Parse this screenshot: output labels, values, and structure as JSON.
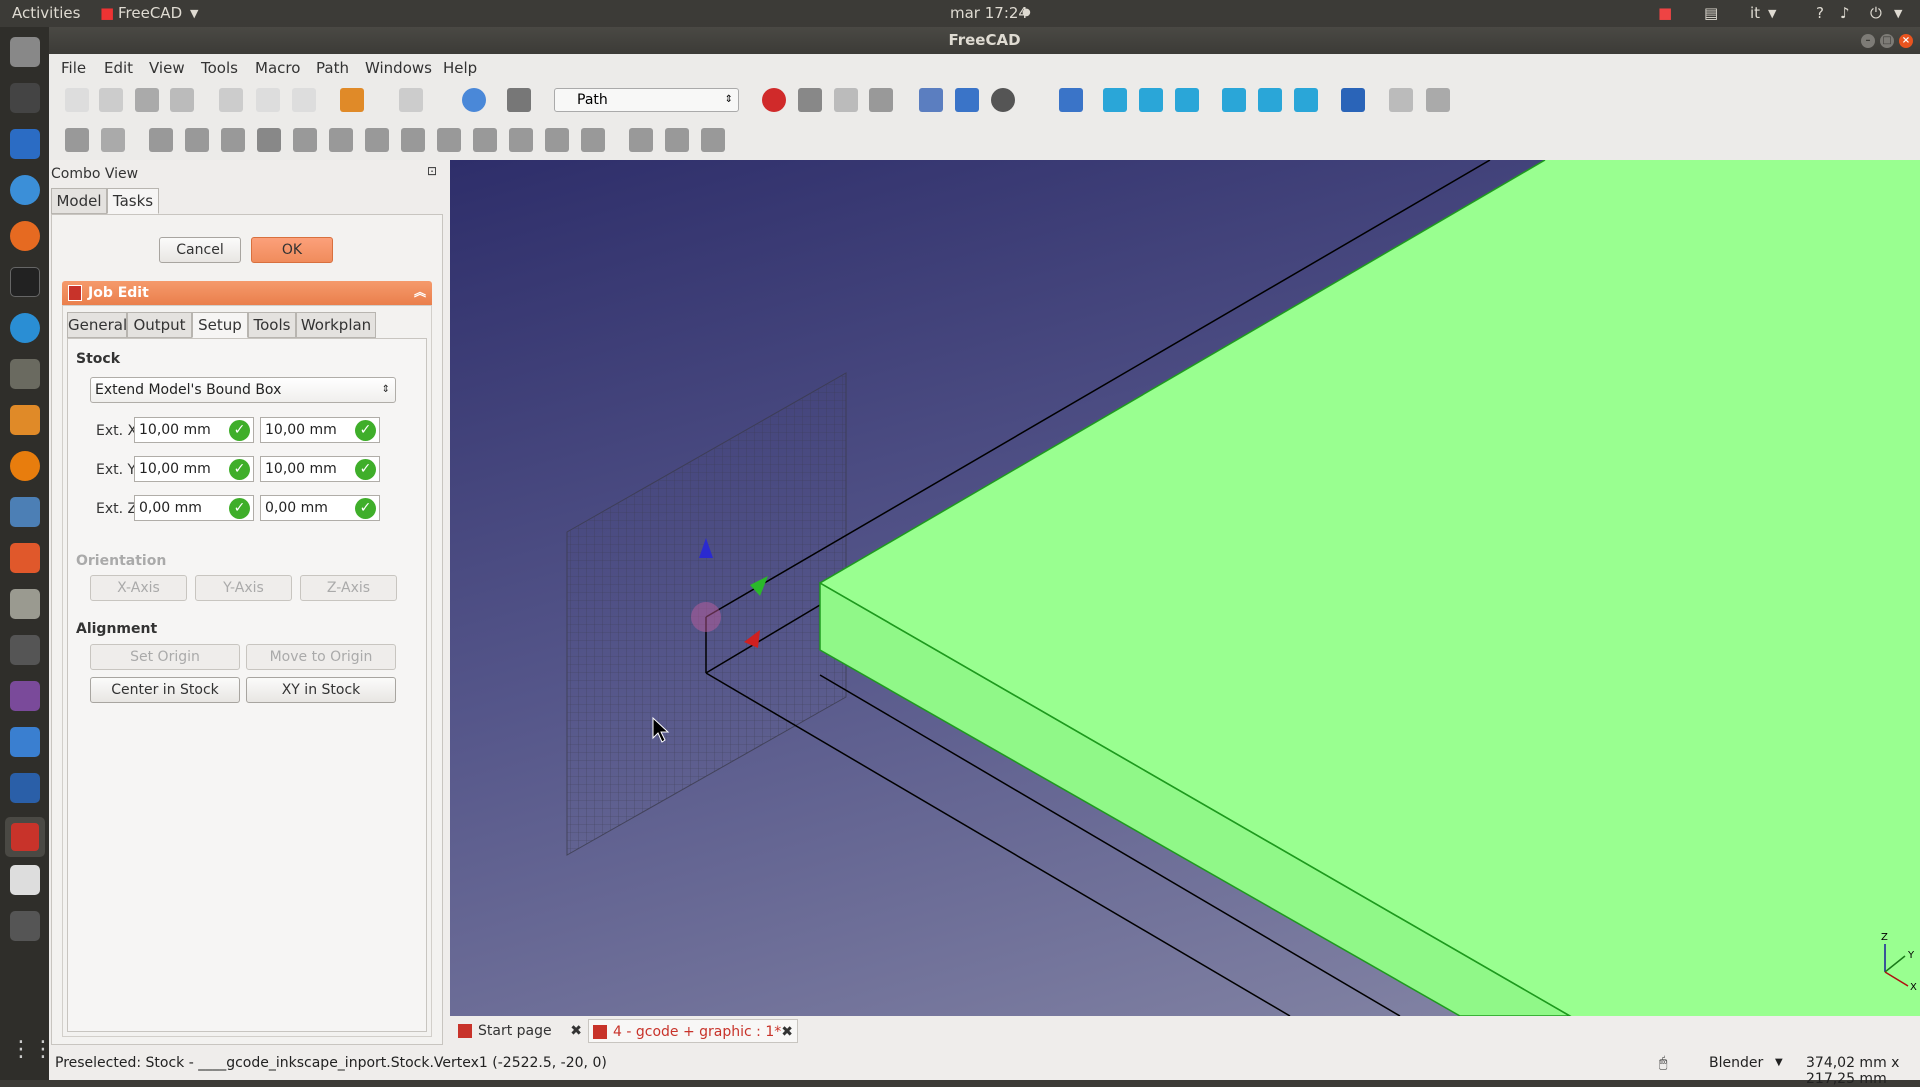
{
  "topbar": {
    "activities": "Activities",
    "app_menu": "FreeCAD",
    "clock": "mar 17:24",
    "lang": "it",
    "help": "?"
  },
  "window": {
    "title": "FreeCAD"
  },
  "menu": [
    "File",
    "Edit",
    "View",
    "Tools",
    "Macro",
    "Path",
    "Windows",
    "Help"
  ],
  "toolbar": {
    "workbench": "Path"
  },
  "combo": {
    "title": "Combo View",
    "tabs": [
      "Model",
      "Tasks"
    ],
    "cancel": "Cancel",
    "ok": "OK",
    "panel_title": "Job Edit",
    "panel_tabs": [
      "General",
      "Output",
      "Setup",
      "Tools",
      "Workplan"
    ],
    "stock_label": "Stock",
    "stock_type": "Extend Model's Bound Box",
    "ext": [
      {
        "label": "Ext. X",
        "a": "10,00 mm",
        "b": "10,00 mm"
      },
      {
        "label": "Ext. Y",
        "a": "10,00 mm",
        "b": "10,00 mm"
      },
      {
        "label": "Ext. Z",
        "a": "0,00 mm",
        "b": "0,00 mm"
      }
    ],
    "orientation_label": "Orientation",
    "orientation_buttons": [
      "X-Axis",
      "Y-Axis",
      "Z-Axis"
    ],
    "alignment_label": "Alignment",
    "alignment_buttons": [
      "Set Origin",
      "Move to Origin",
      "Center in Stock",
      "XY in Stock"
    ]
  },
  "doctabs": [
    "Start page",
    "4 - gcode + graphic : 1*"
  ],
  "status": {
    "text": "Preselected: Stock - ____gcode_inkscape_inport.Stock.Vertex1 (-2522.5, -20, 0)",
    "nav": "Blender",
    "dims": "374,02 mm x 217,25 mm"
  },
  "axis": {
    "z": "Z",
    "y": "Y",
    "x": "X"
  },
  "colors": {
    "accent": "#f08c5c",
    "part": "#99ff90",
    "viewport_top": "#2e2e6a",
    "viewport_bottom": "#8a8ba8"
  }
}
